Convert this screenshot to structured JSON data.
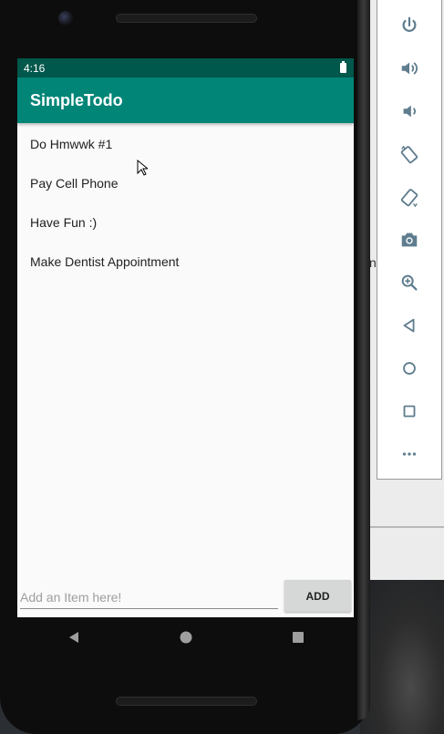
{
  "status_bar": {
    "time": "4:16"
  },
  "app_bar": {
    "title": "SimpleTodo"
  },
  "todo_items": [
    {
      "label": "Do Hmwwk #1"
    },
    {
      "label": "Pay Cell Phone"
    },
    {
      "label": "Have Fun :)"
    },
    {
      "label": "Make Dentist Appointment"
    }
  ],
  "new_item": {
    "placeholder": "Add an Item here!",
    "value": ""
  },
  "add_button": {
    "label": "ADD"
  },
  "background": {
    "fragment": "n"
  },
  "colors": {
    "status_bar": "#00574b",
    "app_bar": "#008577",
    "screen_background": "#fafafa",
    "toolbar_icon": "#5f7d8e"
  },
  "emulator_toolbar": [
    {
      "name": "power-icon"
    },
    {
      "name": "volume-up-icon"
    },
    {
      "name": "volume-down-icon"
    },
    {
      "name": "rotate-left-icon"
    },
    {
      "name": "rotate-right-icon"
    },
    {
      "name": "camera-icon"
    },
    {
      "name": "zoom-icon"
    },
    {
      "name": "back-icon"
    },
    {
      "name": "home-icon"
    },
    {
      "name": "overview-icon"
    },
    {
      "name": "more-icon"
    }
  ],
  "nav_bar": [
    {
      "name": "nav-back-icon"
    },
    {
      "name": "nav-home-icon"
    },
    {
      "name": "nav-recents-icon"
    }
  ]
}
